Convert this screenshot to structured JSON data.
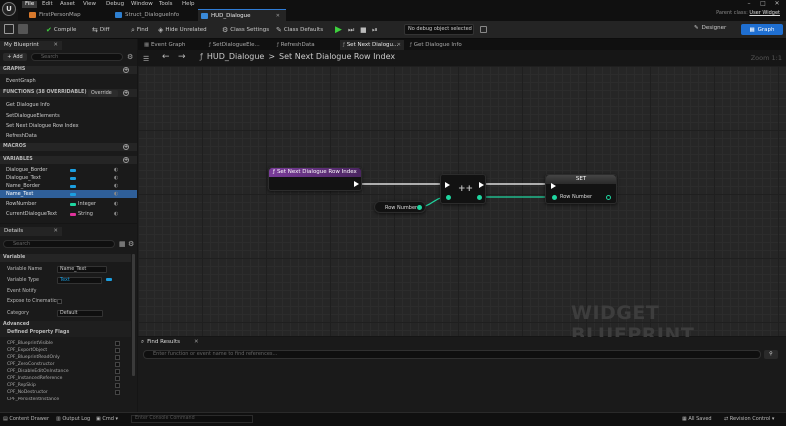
{
  "app": {
    "logo": "U",
    "menu": [
      "File",
      "Edit",
      "Asset",
      "View",
      "Debug",
      "Window",
      "Tools",
      "Help"
    ],
    "window_controls": [
      "–",
      "□",
      "✕"
    ]
  },
  "doc_tabs": [
    {
      "label": "FirstPersonMap",
      "color": "#d8792c"
    },
    {
      "label": "Struct_DialogueInfo",
      "color": "#2e7fd0"
    },
    {
      "label": "HUD_Dialogue",
      "color": "#3a8ad8",
      "close": "✕"
    }
  ],
  "parent_class": {
    "label": "Parent class:",
    "value": "User Widget"
  },
  "toolbar": {
    "compile": "Compile",
    "diff": "Diff",
    "find": "Find",
    "hide_unrelated": "Hide Unrelated",
    "class_settings": "Class Settings",
    "class_defaults": "Class Defaults",
    "debug_object": "No debug object selected",
    "designer": "Designer",
    "graph": "Graph"
  },
  "my_blueprint": {
    "tab_label": "My Blueprint",
    "add_label": "+ Add",
    "search_placeholder": "Search",
    "graphs_header": "GRAPHS",
    "graphs": [
      "EventGraph"
    ],
    "functions_header": "FUNCTIONS (38 OVERRIDABLE)",
    "override_label": "Override",
    "functions": [
      "Get Dialogue Info",
      "SetDialogueElements",
      "Set Next Dialogue Row Index",
      "RefreshData"
    ],
    "macros_header": "MACROS",
    "variables_header": "VARIABLES",
    "variables": [
      {
        "name": "Dialogue_Border",
        "type": "",
        "color": "#1c9fe0"
      },
      {
        "name": "Dialogue_Text",
        "type": "",
        "color": "#1c9fe0"
      },
      {
        "name": "Name_Border",
        "type": "",
        "color": "#1c9fe0"
      },
      {
        "name": "Name_Text",
        "type": "",
        "color": "#1c9fe0",
        "selected": true
      },
      {
        "name": "RowNumber",
        "type": "Integer",
        "color": "#1fd6a0"
      },
      {
        "name": "CurrentDialogueText",
        "type": "String",
        "color": "#e0339b"
      }
    ]
  },
  "details": {
    "tab_label": "Details",
    "search_placeholder": "Search",
    "variable_header": "Variable",
    "fields": {
      "variable_name_label": "Variable Name",
      "variable_name_value": "Name_Text",
      "variable_type_label": "Variable Type",
      "variable_type_value": "Text",
      "event_notify_label": "Event Notify",
      "expose_label": "Expose to Cinematics",
      "category_label": "Category",
      "category_value": "Default"
    },
    "advanced_header": "Advanced",
    "flags_header": "Defined Property Flags",
    "flags": [
      "CPF_BlueprintVisible",
      "CPF_ExportObject",
      "CPF_BlueprintReadOnly",
      "CPF_ZeroConstructor",
      "CPF_DisableEditOnInstance",
      "CPF_InstancedReference",
      "CPF_RepSkip",
      "CPF_NoDestructor",
      "CPF_PersistentInstance"
    ]
  },
  "graph_tabs": [
    "Event Graph",
    "SetDialogueEle...",
    "RefreshData",
    "Set Next Dialogu...",
    "Get Dialogue Info"
  ],
  "breadcrumb": {
    "root": "HUD_Dialogue",
    "sep": ">",
    "current": "Set Next Dialogue Row Index"
  },
  "zoom": "Zoom 1:1",
  "watermark": "WIDGET BLUEPRINT",
  "nodes": {
    "entry": {
      "title": "Set Next Dialogue Row Index",
      "header_color": "#7a3c9a"
    },
    "getter": {
      "label": "Row Number"
    },
    "increment": {
      "label": "++"
    },
    "setter": {
      "title": "SET",
      "pin_label": "Row Number"
    }
  },
  "find_results": {
    "tab_label": "Find Results",
    "placeholder": "Enter function or event name to find references..."
  },
  "statusbar": {
    "content_drawer": "Content Drawer",
    "output_log": "Output Log",
    "cmd": "Cmd",
    "console_placeholder": "Enter Console Command",
    "saved": "All Saved",
    "revision": "Revision Control"
  }
}
